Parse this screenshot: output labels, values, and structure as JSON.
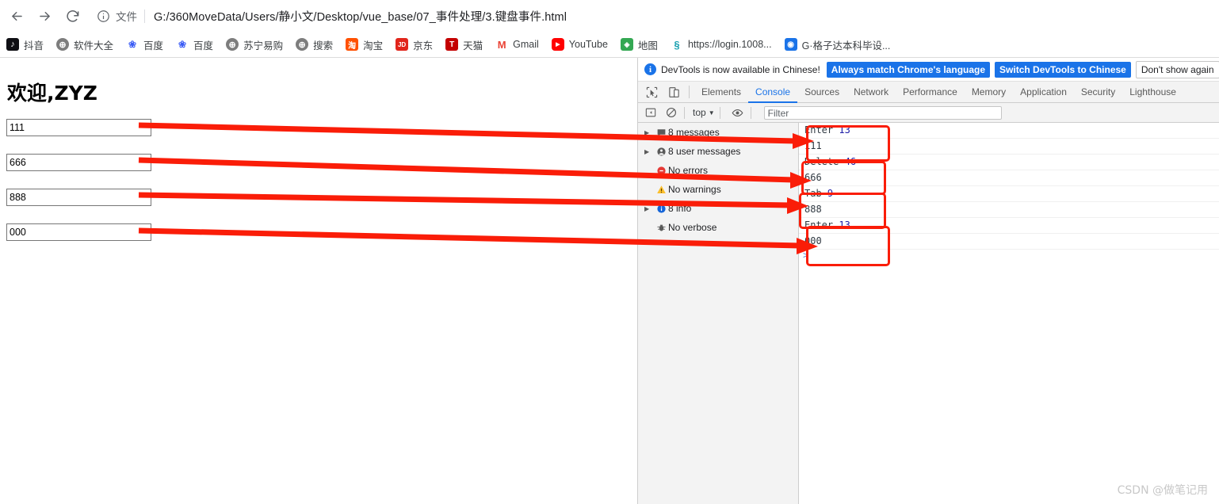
{
  "browser": {
    "back_icon": "arrow-left-icon",
    "forward_icon": "arrow-right-icon",
    "reload_icon": "reload-icon",
    "info_icon": "info-circle-icon",
    "file_label": "文件",
    "url": "G:/360MoveData/Users/静小文/Desktop/vue_base/07_事件处理/3.键盘事件.html"
  },
  "bookmarks": [
    {
      "label": "抖音",
      "icon": "douyin-icon",
      "color": "#1a1a1a",
      "glyph": "♪"
    },
    {
      "label": "软件大全",
      "icon": "globe-icon",
      "color": "#7a7a7a",
      "glyph": "⊕"
    },
    {
      "label": "百度",
      "icon": "baidu-icon",
      "color": "#ffffff",
      "glyph": "🐾"
    },
    {
      "label": "百度",
      "icon": "baidu-icon",
      "color": "#ffffff",
      "glyph": "🐾"
    },
    {
      "label": "苏宁易购",
      "icon": "globe-icon",
      "color": "#7a7a7a",
      "glyph": "⊕"
    },
    {
      "label": "搜索",
      "icon": "globe-icon",
      "color": "#7a7a7a",
      "glyph": "⊕"
    },
    {
      "label": "淘宝",
      "icon": "taobao-icon",
      "color": "#ff5000",
      "glyph": "淘"
    },
    {
      "label": "京东",
      "icon": "jd-icon",
      "color": "#e1251b",
      "glyph": "JD"
    },
    {
      "label": "天猫",
      "icon": "tmall-icon",
      "color": "#c40000",
      "glyph": "T"
    },
    {
      "label": "Gmail",
      "icon": "gmail-icon",
      "color": "#ffffff",
      "glyph": "M"
    },
    {
      "label": "YouTube",
      "icon": "youtube-icon",
      "color": "#ff0000",
      "glyph": "▶"
    },
    {
      "label": "地图",
      "icon": "map-icon",
      "color": "#34a853",
      "glyph": "📍"
    },
    {
      "label": "https://login.1008...",
      "icon": "link-icon",
      "color": "#ffffff",
      "glyph": "§"
    },
    {
      "label": "G·格子达本科毕设...",
      "icon": "gezida-icon",
      "color": "#1a73e8",
      "glyph": "G"
    }
  ],
  "page": {
    "heading": "欢迎,ZYZ",
    "inputs": [
      {
        "name": "input-111",
        "value": "111"
      },
      {
        "name": "input-666",
        "value": "666"
      },
      {
        "name": "input-888",
        "value": "888"
      },
      {
        "name": "input-000",
        "value": "000"
      }
    ],
    "input_placeholder": ""
  },
  "devtools": {
    "notice": {
      "icon": "info-circle-icon",
      "text": "DevTools is now available in Chinese!",
      "primary_button": "Always match Chrome's language",
      "secondary_button": "Switch DevTools to Chinese",
      "dismiss_button": "Don't show again"
    },
    "inspect_icon": "inspect-cursor-icon",
    "device_icon": "device-toolbar-icon",
    "tabs": [
      {
        "label": "Elements",
        "active": false
      },
      {
        "label": "Console",
        "active": true
      },
      {
        "label": "Sources",
        "active": false
      },
      {
        "label": "Network",
        "active": false
      },
      {
        "label": "Performance",
        "active": false
      },
      {
        "label": "Memory",
        "active": false
      },
      {
        "label": "Application",
        "active": false
      },
      {
        "label": "Security",
        "active": false
      },
      {
        "label": "Lighthouse",
        "active": false
      }
    ],
    "toolbar": {
      "sidebar_toggle_icon": "console-sidebar-toggle-icon",
      "clear_icon": "clear-console-icon",
      "context": "top",
      "context_caret": "▼",
      "eye_icon": "live-expression-eye-icon",
      "filter_placeholder": "Filter",
      "filter_value": ""
    },
    "sidebar": [
      {
        "label": "8 messages",
        "icon": "messages-icon",
        "expandable": true
      },
      {
        "label": "8 user messages",
        "icon": "user-message-icon",
        "expandable": true
      },
      {
        "label": "No errors",
        "icon": "error-icon",
        "expandable": false
      },
      {
        "label": "No warnings",
        "icon": "warning-icon",
        "expandable": false
      },
      {
        "label": "8 info",
        "icon": "info-icon",
        "expandable": true
      },
      {
        "label": "No verbose",
        "icon": "verbose-bug-icon",
        "expandable": false
      }
    ],
    "console_rows": [
      {
        "key": "Enter",
        "code": "13"
      },
      {
        "value": "111"
      },
      {
        "key": "Delete",
        "code": "46"
      },
      {
        "value": "666"
      },
      {
        "key": "Tab",
        "code": "9"
      },
      {
        "value": "888"
      },
      {
        "key": "Enter",
        "code": "13"
      },
      {
        "value": "000"
      }
    ],
    "prompt_symbol": ">"
  },
  "annotations": {
    "color": "#fa1d08",
    "boxes": [
      {
        "name": "annotation-box-enter-13-111"
      },
      {
        "name": "annotation-box-delete-46-666"
      },
      {
        "name": "annotation-box-tab-9-888"
      },
      {
        "name": "annotation-box-enter-13-000"
      }
    ]
  },
  "watermark": "CSDN @做笔记用"
}
